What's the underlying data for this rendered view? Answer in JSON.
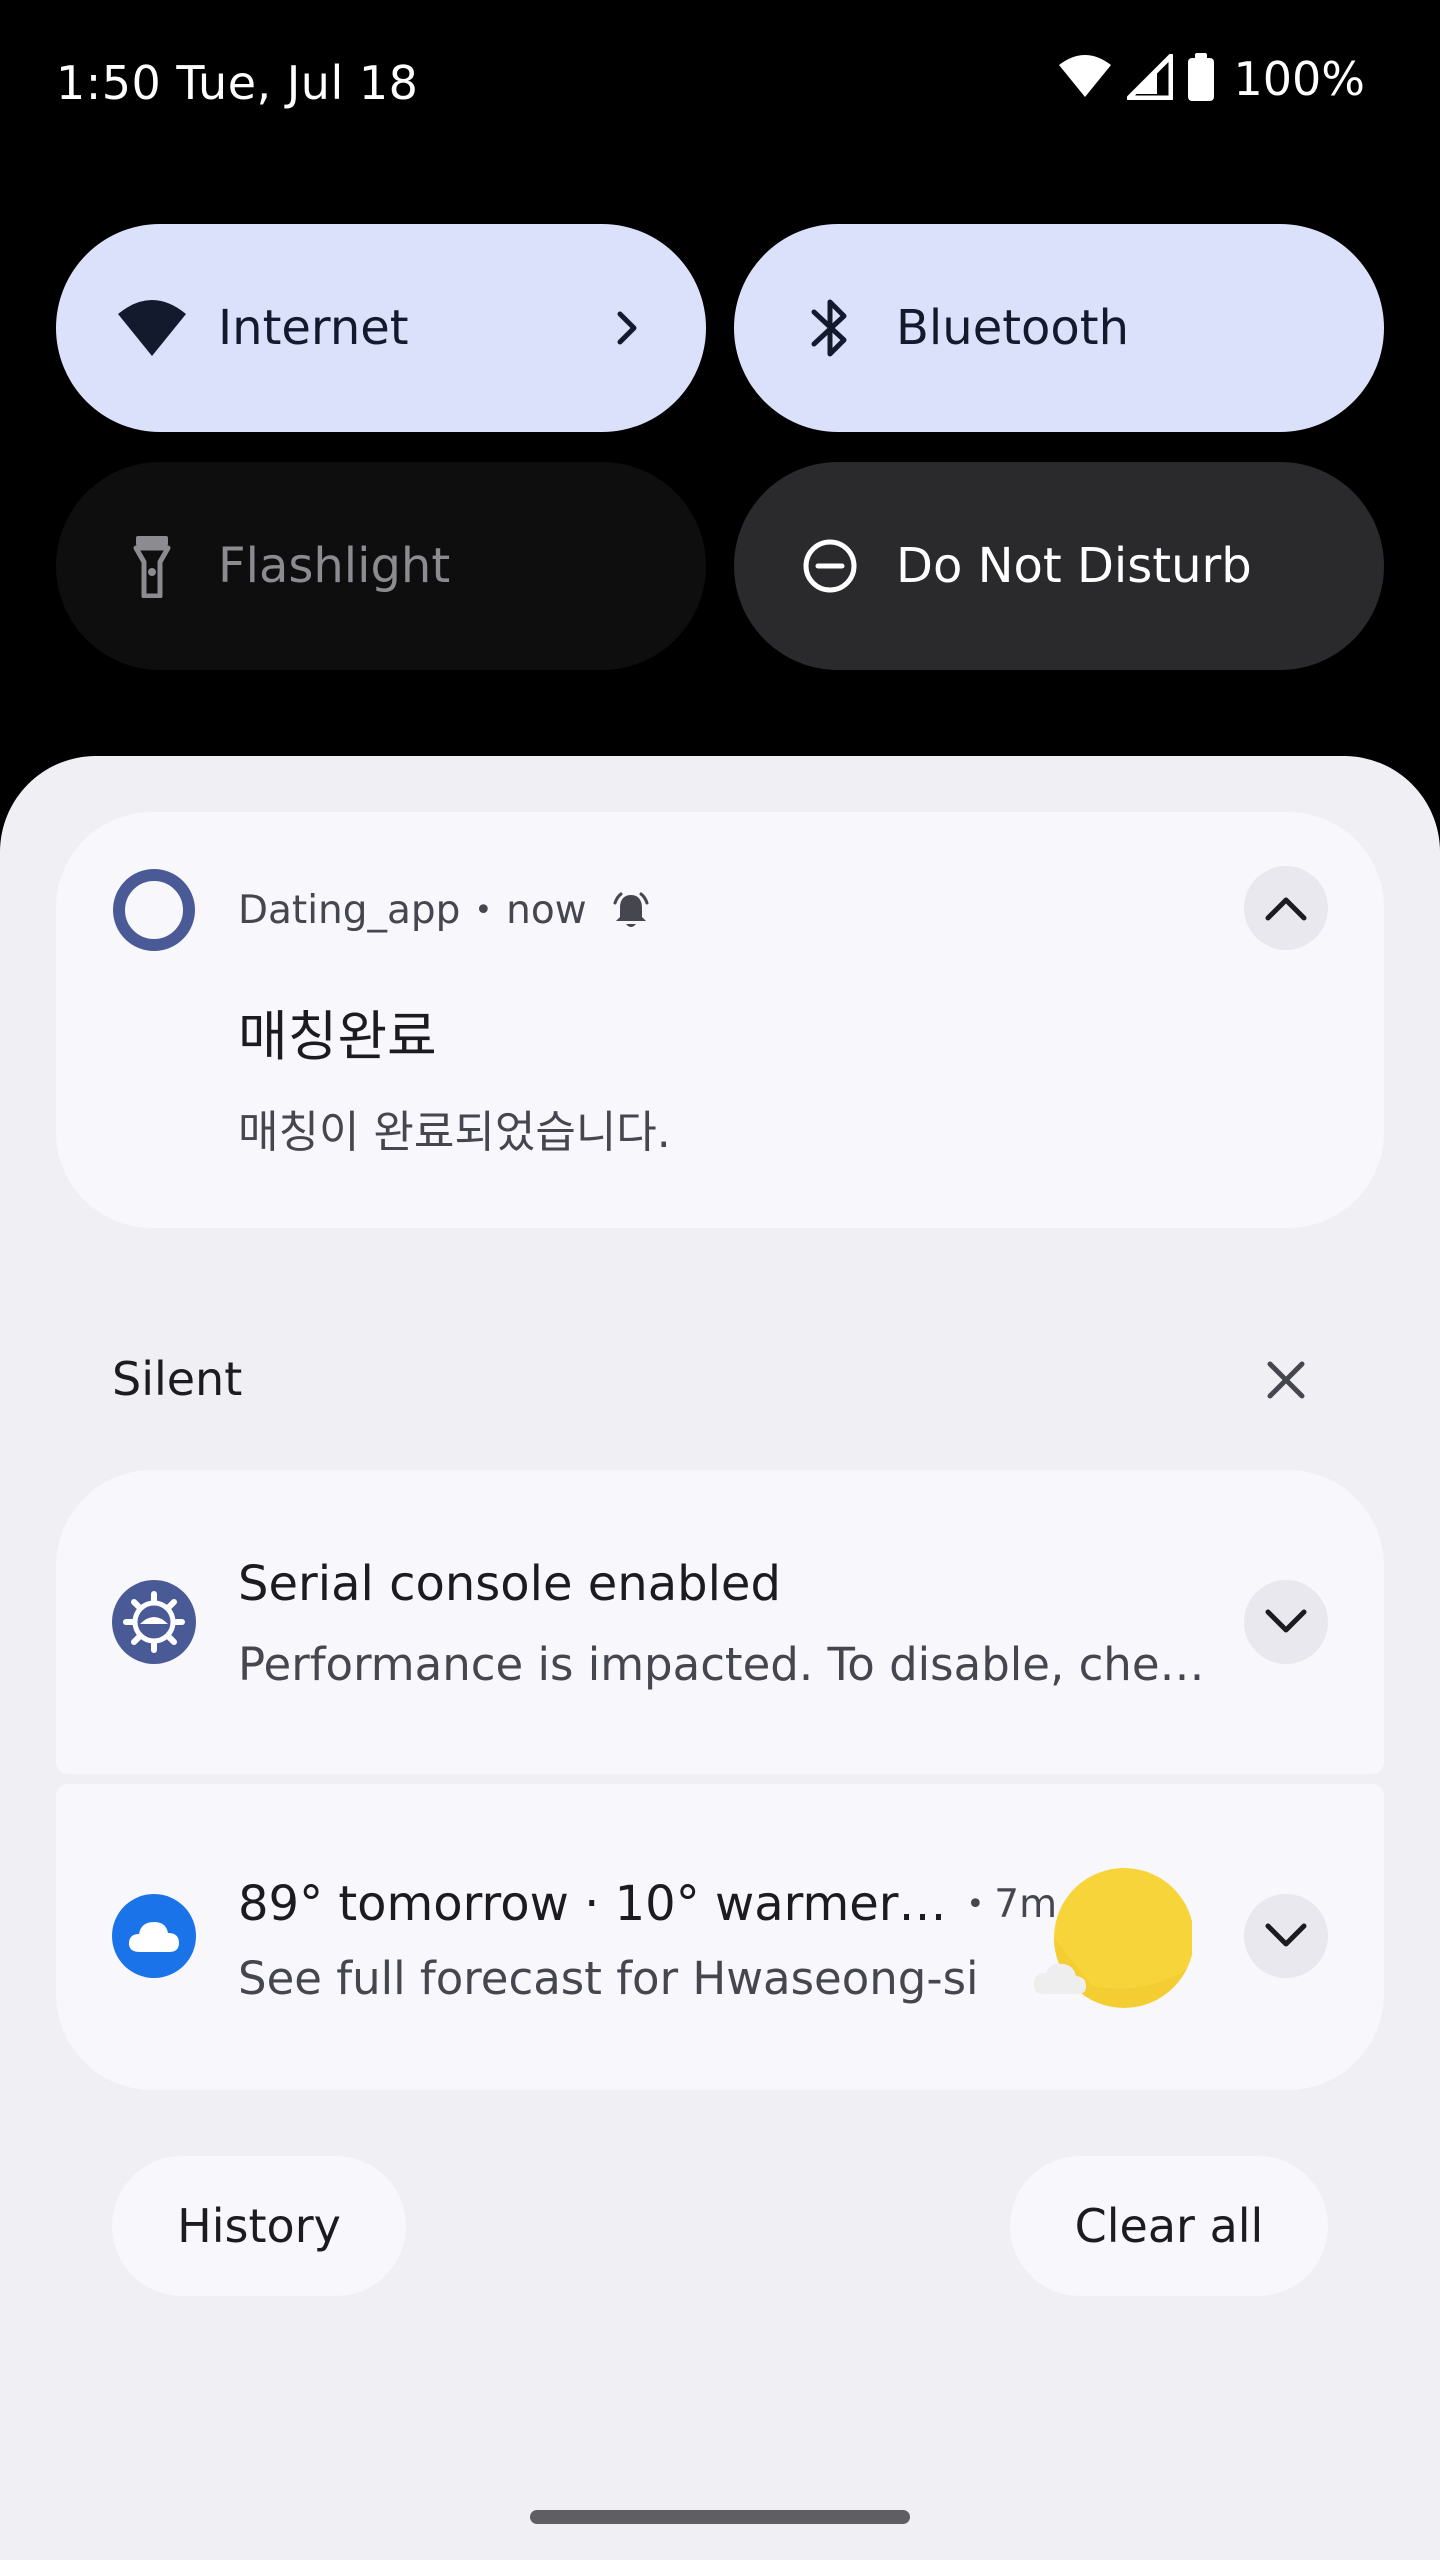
{
  "status_bar": {
    "time_date": "1:50 Tue, Jul 18",
    "battery_text": "100%",
    "icons": [
      "wifi-icon",
      "cell-signal-icon",
      "battery-icon"
    ]
  },
  "quick_settings": {
    "tiles": [
      {
        "label": "Internet",
        "icon": "wifi-icon",
        "state": "on",
        "has_chevron": true
      },
      {
        "label": "Bluetooth",
        "icon": "bluetooth-icon",
        "state": "on"
      },
      {
        "label": "Flashlight",
        "icon": "flashlight-icon",
        "state": "unavailable"
      },
      {
        "label": "Do Not Disturb",
        "icon": "do-not-disturb-icon",
        "state": "off"
      }
    ]
  },
  "notifications": {
    "dating": {
      "app_name": "Dating_app",
      "time": "now",
      "title": "매칭완료",
      "text": "매칭이 완료되었습니다.",
      "icon": "ring-icon",
      "alert_icon": "bell-icon"
    },
    "silent_section": {
      "label": "Silent"
    },
    "serial": {
      "title": "Serial console enabled",
      "text": "Performance is impacted. To disable, che…",
      "icon": "android-gear-icon"
    },
    "weather": {
      "title": "89° tomorrow · 10° warmer…",
      "time": "7m",
      "text": "See full forecast for Hwaseong-si",
      "icon": "cloud-icon",
      "thumbnail": "sun-icon"
    }
  },
  "actions": {
    "history": "History",
    "clear_all": "Clear all"
  },
  "colors": {
    "tile_on": "#dbe1fb",
    "tile_off": "#2a2a2d",
    "shade_bg": "#f0eff4",
    "card_bg": "#f8f7fc",
    "app_icon_blue": "#4a5a96",
    "weather_blue": "#1a73e8",
    "sun_yellow": "#f6d43a"
  }
}
